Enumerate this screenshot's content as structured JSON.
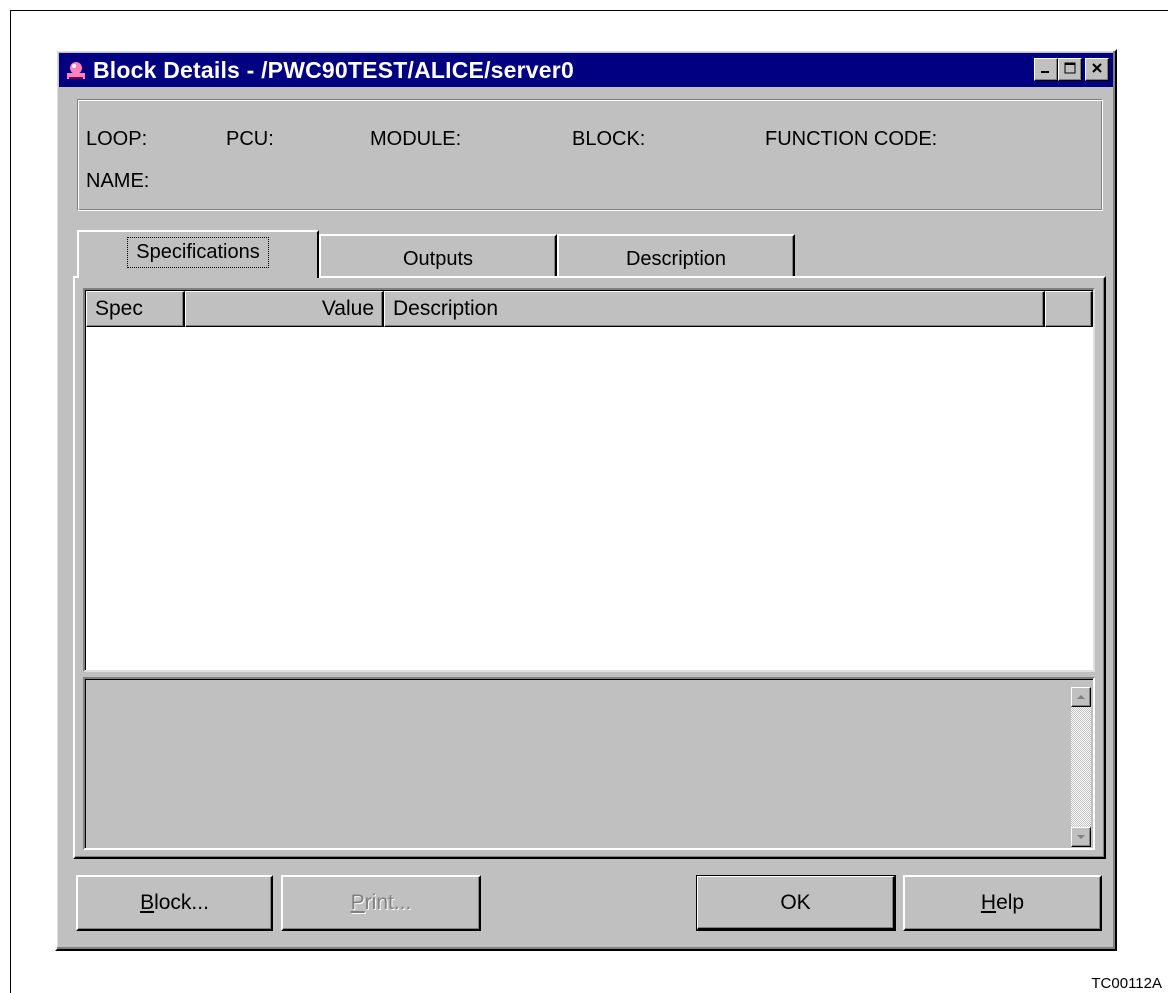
{
  "window": {
    "title": "Block Details - /PWC90TEST/ALICE/server0"
  },
  "info": {
    "loop_label": "LOOP:",
    "pcu_label": "PCU:",
    "module_label": "MODULE:",
    "block_label": "BLOCK:",
    "function_code_label": "FUNCTION CODE:",
    "name_label": "NAME:"
  },
  "tabs": [
    {
      "label": "Specifications",
      "active": true
    },
    {
      "label": "Outputs",
      "active": false
    },
    {
      "label": "Description",
      "active": false
    }
  ],
  "table": {
    "columns": [
      "Spec",
      "Value",
      "Description"
    ],
    "rows": []
  },
  "buttons": {
    "block": {
      "mnemonic": "B",
      "rest": "lock..."
    },
    "print": {
      "mnemonic": "P",
      "rest": "rint..."
    },
    "ok": "OK",
    "help": {
      "mnemonic": "H",
      "rest": "elp"
    }
  },
  "figure_id": "TC00112A",
  "colors": {
    "titlebar": "#000080",
    "face": "#c0c0c0"
  },
  "icons": {
    "app": "app-icon",
    "minimize": "minimize-icon",
    "maximize": "maximize-icon",
    "close": "close-icon",
    "scroll_up": "arrow-up-icon",
    "scroll_down": "arrow-down-icon"
  }
}
